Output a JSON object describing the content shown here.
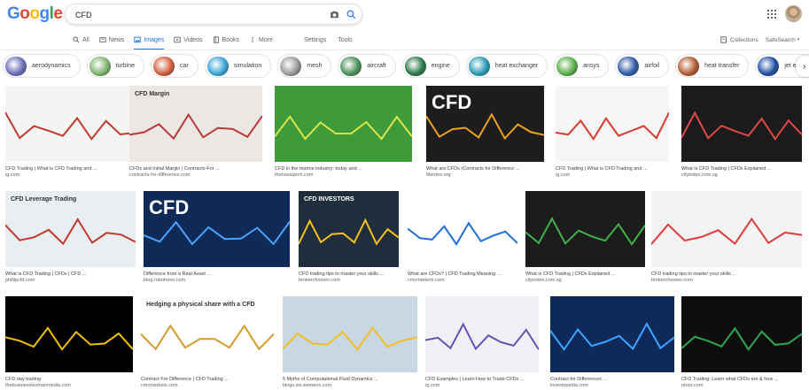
{
  "logo": "Google",
  "search": {
    "query": "CFD"
  },
  "tabs": [
    {
      "label": "All",
      "icon": "search-icon",
      "active": false
    },
    {
      "label": "News",
      "icon": "news-icon",
      "active": false
    },
    {
      "label": "Images",
      "icon": "image-icon",
      "active": true
    },
    {
      "label": "Videos",
      "icon": "video-icon",
      "active": false
    },
    {
      "label": "Books",
      "icon": "book-icon",
      "active": false
    },
    {
      "label": "More",
      "icon": "more-icon",
      "active": false
    }
  ],
  "tools": {
    "settings": "Settings",
    "tools": "Tools"
  },
  "right": {
    "collections": "Collections",
    "safesearch": "SafeSearch"
  },
  "chips": [
    {
      "label": "aerodynamics",
      "color": "#6d6fb8"
    },
    {
      "label": "turbine",
      "color": "#7fb56f"
    },
    {
      "label": "car",
      "color": "#d2603c"
    },
    {
      "label": "simulation",
      "color": "#3aa6d8"
    },
    {
      "label": "mesh",
      "color": "#9a9a9a"
    },
    {
      "label": "aircraft",
      "color": "#4c8f5a"
    },
    {
      "label": "engine",
      "color": "#2c7a4b"
    },
    {
      "label": "heat exchanger",
      "color": "#2a9bb5"
    },
    {
      "label": "ansys",
      "color": "#5ab04a"
    },
    {
      "label": "airfoil",
      "color": "#2f5aa8"
    },
    {
      "label": "heat transfer",
      "color": "#b35a2f"
    },
    {
      "label": "jet engine",
      "color": "#1f4fa3"
    },
    {
      "label": "",
      "color": "#3d6f8f"
    }
  ],
  "results": [
    {
      "caption": "CFD Trading | What is CFD Trading and ...",
      "source": "ig.com",
      "bg": "#f4f4f4",
      "accent": "#c0392b",
      "label": ""
    },
    {
      "caption": "CFDs and Initial Margin | Contracts-For ...",
      "source": "contracts-for-difference.com",
      "bg": "#ece7e3",
      "accent": "#b83a3a",
      "label": "CFD Margin"
    },
    {
      "caption": "CFD in the marine industry: today and ...",
      "source": "thenavalarch.com",
      "bg": "#3f9a3a",
      "accent": "#d9e64b",
      "label": ""
    },
    {
      "caption": "What are CFDs (Contracts for Difference ...",
      "source": "fibertex.org",
      "bg": "#1d1d1d",
      "accent": "#f0a020",
      "label": "CFD"
    },
    {
      "caption": "CFD Trading | What is CFD Trading and ...",
      "source": "ig.com",
      "bg": "#f5f5f5",
      "accent": "#d63b2e",
      "label": ""
    },
    {
      "caption": "What is CFD Trading | CFDs Explained ...",
      "source": "cityindex.com.sg",
      "bg": "#1b1b1b",
      "accent": "#e04848",
      "label": ""
    },
    {
      "caption": "What is CFD Trading | CFDs | CFD ...",
      "source": "phillipcfd.com",
      "bg": "#e9eef3",
      "accent": "#c0392b",
      "label": "CFD Leverage Trading"
    },
    {
      "caption": "Difference from a Real Asset ...",
      "source": "blog.roboforex.com",
      "bg": "#0f2a56",
      "accent": "#4aa3ff",
      "label": "CFD"
    },
    {
      "caption": "CFD trading tips to master your skills ...",
      "source": "brokerchooser.com",
      "bg": "#1f2d3d",
      "accent": "#f4c21b",
      "label": "CFD INVESTORS"
    },
    {
      "caption": "What are CFDs? | CFD Trading Meaning ...",
      "source": "cmcmarkets.com",
      "bg": "#ffffff",
      "accent": "#1e6fd9",
      "label": ""
    },
    {
      "caption": "What is CFD Trading | CFDs Explained ...",
      "source": "cityindex.com.sg",
      "bg": "#1c1c1c",
      "accent": "#3fb04c",
      "label": ""
    },
    {
      "caption": "CFD trading tips to master your skills ...",
      "source": "brokerchooser.com",
      "bg": "#f3f3f3",
      "accent": "#e03a3a",
      "label": ""
    },
    {
      "caption": "CFD day trading",
      "source": "thebusinesswomanmedia.com",
      "bg": "#000000",
      "accent": "#f0c000",
      "label": ""
    },
    {
      "caption": "Contract For Difference | CFD Trading ...",
      "source": "cmcmarkets.com",
      "bg": "#ffffff",
      "accent": "#d49a2a",
      "label": "Hedging a physical share with a CFD"
    },
    {
      "caption": "5 Myths of Computational Fluid Dynamics ...",
      "source": "blogs.sw.siemens.com",
      "bg": "#c9d6e4",
      "accent": "#f0c020",
      "label": ""
    },
    {
      "caption": "CFD Examples | Learn How to Trade CFDs ...",
      "source": "ig.com",
      "bg": "#eef0f5",
      "accent": "#6b4fb3",
      "label": ""
    },
    {
      "caption": "Contract for Differences ...",
      "source": "investopedia.com",
      "bg": "#0d2a5a",
      "accent": "#3fa3ff",
      "label": ""
    },
    {
      "caption": "CFD Trading: Learn what CFDs are & how ...",
      "source": "etoro.com",
      "bg": "#0e0e0e",
      "accent": "#2ea84e",
      "label": ""
    }
  ]
}
